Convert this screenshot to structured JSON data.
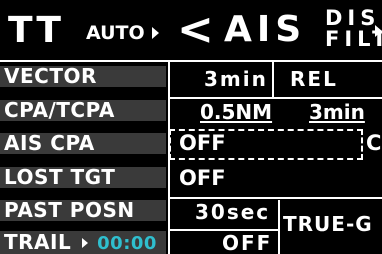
{
  "header": {
    "mode_title": "TT",
    "mode_value": "AUTO",
    "back_symbol": "<",
    "ais_title": "AIS",
    "disp_filt_line1": "DISP",
    "disp_filt_line2": "FILT"
  },
  "rows": {
    "vector": {
      "label": "VECTOR",
      "value": "3min",
      "mode": "REL"
    },
    "cpa_tcpa": {
      "label": "CPA/TCPA",
      "value": "0.5NM",
      "time": "3min"
    },
    "ais_cpa": {
      "label": "AIS CPA",
      "value": "OFF",
      "side_mark": "C"
    },
    "lost_tgt": {
      "label": "LOST TGT",
      "value": "OFF"
    },
    "past_posn": {
      "label": "PAST POSN",
      "value": "30sec",
      "mode": "TRUE-G"
    },
    "trail": {
      "label": "TRAIL",
      "time": "00:00",
      "value": "OFF"
    }
  },
  "colors": {
    "trail_time": "#2fbfcf",
    "label_bg": "#3a3a3a",
    "background": "#000000"
  }
}
